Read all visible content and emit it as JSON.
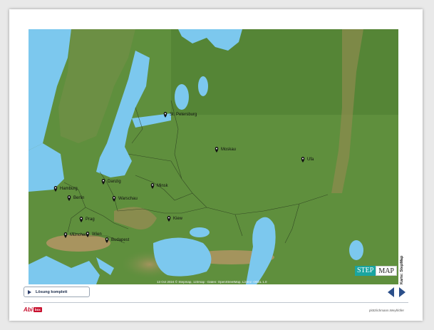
{
  "map": {
    "credit": "13 Oct 2024 © Stepmap, 123map - Daten: OpenStreetMap, Lizenz: ODbL 1.0",
    "logo_part1": "STEP",
    "logo_part2": "MAP",
    "side_credit": "Karte: StepMap",
    "cities": [
      {
        "name": "St. Petersburg"
      },
      {
        "name": "Moskau"
      },
      {
        "name": "Ufa"
      },
      {
        "name": "Danzig"
      },
      {
        "name": "Minsk"
      },
      {
        "name": "Hamburg"
      },
      {
        "name": "Berlin"
      },
      {
        "name": "Warschau"
      },
      {
        "name": "Kiew"
      },
      {
        "name": "Prag"
      },
      {
        "name": "München"
      },
      {
        "name": "Wien"
      },
      {
        "name": "Budapest"
      }
    ]
  },
  "controls": {
    "solution_label": "Lösung komplett"
  },
  "footer": {
    "logo_text": "Abi",
    "logo_badge": "box",
    "copyright": "plötzlichmann.Weyhlöfer"
  },
  "colors": {
    "sea": "#7cc8ee",
    "land": "#5e8f3c",
    "mountain": "#a98a55",
    "nav_arrow": "#2b4f8a",
    "brand": "#c8102e"
  }
}
